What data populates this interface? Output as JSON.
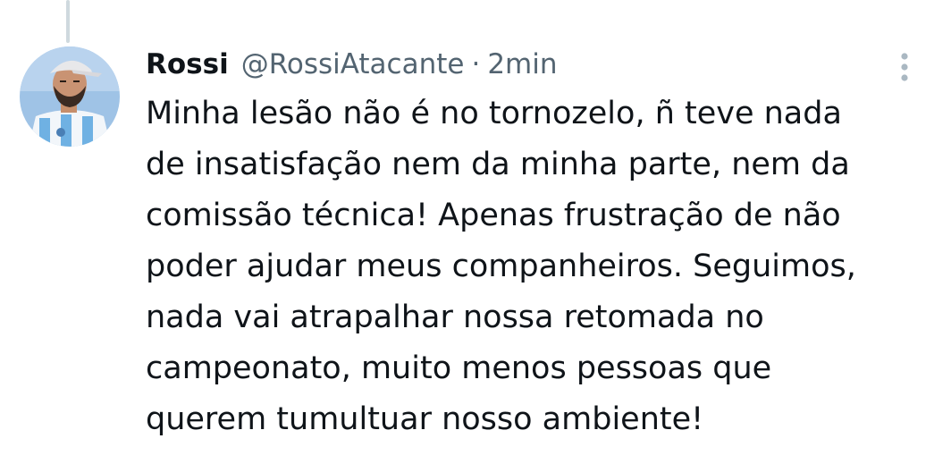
{
  "tweet": {
    "display_name": "Rossi",
    "handle": "@RossiAtacante",
    "separator": "·",
    "time": "2min",
    "lines": [
      "Minha lesão não é no tornozelo, ñ teve nada",
      "de insatisfação nem da minha parte, nem da",
      "comissão técnica! Apenas frustração de não",
      "poder ajudar meus companheiros. Seguimos,",
      "nada vai atrapalhar nossa retomada no",
      "campeonato, muito menos pessoas que",
      "querem tumultuar nosso ambiente!"
    ]
  },
  "icons": {
    "more": "more-vertical-icon",
    "avatar": "avatar"
  },
  "colors": {
    "text": "#0f1419",
    "secondary": "#536471",
    "thread_line": "#cfd9de",
    "background": "#ffffff"
  }
}
